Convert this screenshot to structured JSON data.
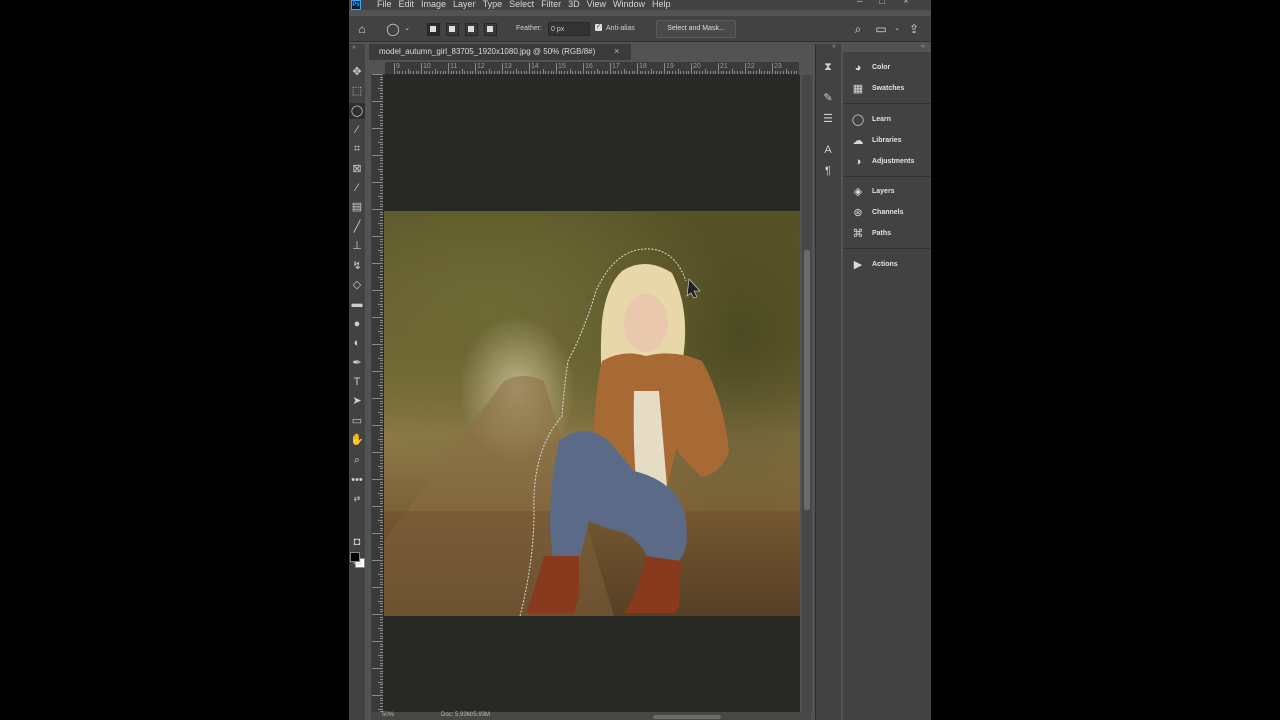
{
  "app": {
    "logo": "Ps"
  },
  "menu": [
    "File",
    "Edit",
    "Image",
    "Layer",
    "Type",
    "Select",
    "Filter",
    "3D",
    "View",
    "Window",
    "Help"
  ],
  "options": {
    "feather_label": "Feather:",
    "feather_value": "0 px",
    "antialias_label": "Anti-alias",
    "select_mask_label": "Select and Mask..."
  },
  "document": {
    "tab_title": "model_autumn_girl_83705_1920x1080.jpg @ 50% (RGB/8#)",
    "close": "×"
  },
  "ruler": {
    "top_numbers": [
      "9",
      "10",
      "11",
      "12",
      "13",
      "14",
      "15",
      "16",
      "17",
      "18",
      "19",
      "20",
      "21",
      "22",
      "23"
    ]
  },
  "status": {
    "zoom": "50%",
    "doc": "Doc: 5.93M/5.93M"
  },
  "panels": [
    {
      "icon": "color-wheel-icon",
      "label": "Color"
    },
    {
      "icon": "swatches-grid-icon",
      "label": "Swatches"
    },
    {
      "icon": "lightbulb-icon",
      "label": "Learn"
    },
    {
      "icon": "libraries-cloud-icon",
      "label": "Libraries"
    },
    {
      "icon": "adjustments-half-circle-icon",
      "label": "Adjustments"
    },
    {
      "icon": "layers-stack-icon",
      "label": "Layers"
    },
    {
      "icon": "channels-circles-icon",
      "label": "Channels"
    },
    {
      "icon": "paths-pen-icon",
      "label": "Paths"
    },
    {
      "icon": "actions-play-icon",
      "label": "Actions"
    }
  ],
  "colors": {
    "foreground": "#000000",
    "background": "#ffffff"
  }
}
